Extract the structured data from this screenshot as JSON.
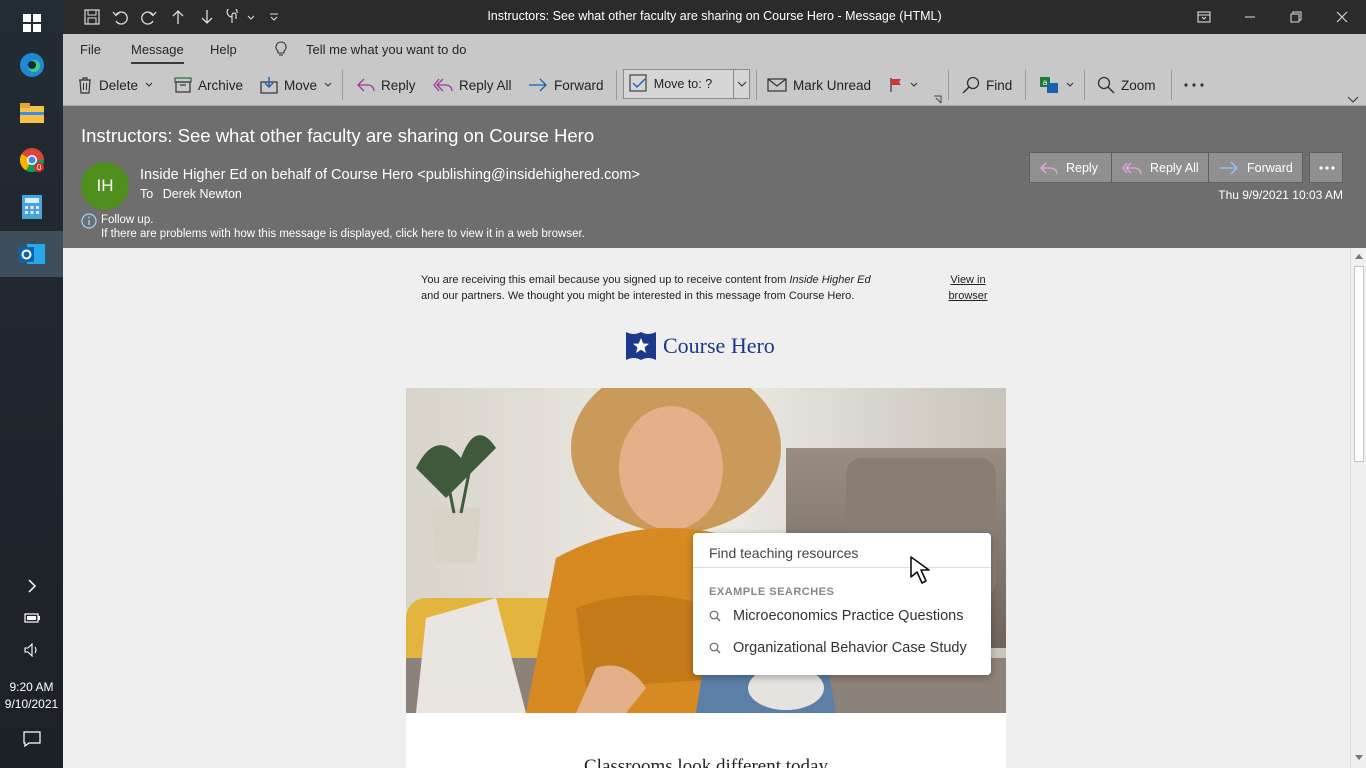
{
  "taskbar": {
    "time": "9:20 AM",
    "date": "9/10/2021",
    "badge_count": "0"
  },
  "window": {
    "title": "Instructors: See what other faculty are sharing on Course Hero  -  Message (HTML)"
  },
  "ribbon_tabs": {
    "file": "File",
    "message": "Message",
    "help": "Help",
    "tell_me": "Tell me what you want to do"
  },
  "ribbon": {
    "delete": "Delete",
    "archive": "Archive",
    "move": "Move",
    "reply": "Reply",
    "reply_all": "Reply All",
    "forward": "Forward",
    "move_to": "Move to: ?",
    "mark_unread": "Mark Unread",
    "find": "Find",
    "zoom": "Zoom"
  },
  "message": {
    "subject": "Instructors: See what other faculty are sharing on Course Hero",
    "avatar_initials": "IH",
    "sender": "Inside Higher Ed on behalf of Course Hero <publishing@insidehighered.com>",
    "to_label": "To",
    "to_name": "Derek Newton",
    "date": "Thu 9/9/2021 10:03 AM",
    "follow_up": "Follow up.",
    "display_problem": "If there are problems with how this message is displayed, click here to view it in a web browser.",
    "actions": {
      "reply": "Reply",
      "reply_all": "Reply All",
      "forward": "Forward"
    }
  },
  "email": {
    "notice_line1": "You are receiving this email because you signed up to receive content from ",
    "notice_source": "Inside Higher Ed",
    "notice_line2": "and our partners. We thought you might be interested in this message from Course Hero.",
    "view_in": "View in",
    "browser": "browser",
    "logo_text": "Course Hero",
    "search_placeholder": "Find teaching resources",
    "example_label": "EXAMPLE SEARCHES",
    "examples": [
      "Microeconomics Practice Questions",
      "Organizational Behavior Case Study"
    ],
    "heading": "Classrooms look different today"
  },
  "colors": {
    "avatar": "#4f8f1e",
    "header_bg": "#6e6e6e",
    "ribbon_bg": "#c8c8c8",
    "brand": "#1b3a8c"
  }
}
